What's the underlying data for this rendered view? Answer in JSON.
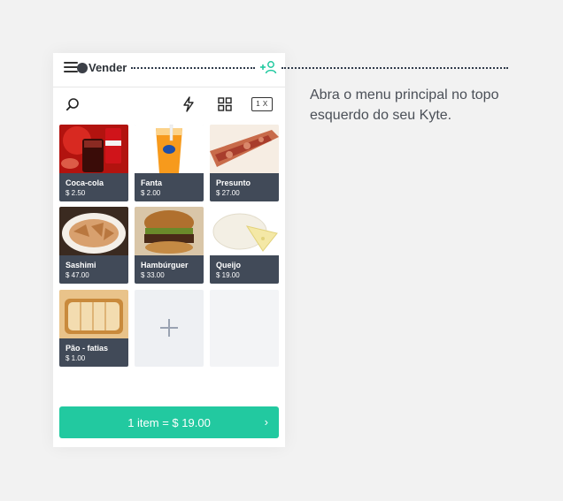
{
  "header": {
    "title": "Vender"
  },
  "toolbar": {
    "qty_label": "1 X"
  },
  "products": [
    {
      "name": "Coca-cola",
      "price": "$ 2.50",
      "photo": "cola"
    },
    {
      "name": "Fanta",
      "price": "$ 2.00",
      "photo": "fanta"
    },
    {
      "name": "Presunto",
      "price": "$ 27.00",
      "photo": "ham"
    },
    {
      "name": "Sashimi",
      "price": "$ 47.00",
      "photo": "sashimi"
    },
    {
      "name": "Hambúrguer",
      "price": "$ 33.00",
      "photo": "burger"
    },
    {
      "name": "Queijo",
      "price": "$ 19.00",
      "photo": "cheese"
    },
    {
      "name": "Pão - fatias",
      "price": "$ 1.00",
      "photo": "bread"
    }
  ],
  "checkout": {
    "label": "1 item = $ 19.00",
    "arrow": "›"
  },
  "hint": {
    "text": "Abra o menu principal no topo esquerdo do seu Kyte."
  },
  "colors": {
    "accent": "#22c9a0",
    "tile_info": "#414a58",
    "guide": "#2f3a4a"
  },
  "icons": [
    "menu-icon",
    "add-user-icon",
    "search-icon",
    "bolt-icon",
    "grid-icon",
    "plus-icon",
    "chevron-right-icon"
  ]
}
